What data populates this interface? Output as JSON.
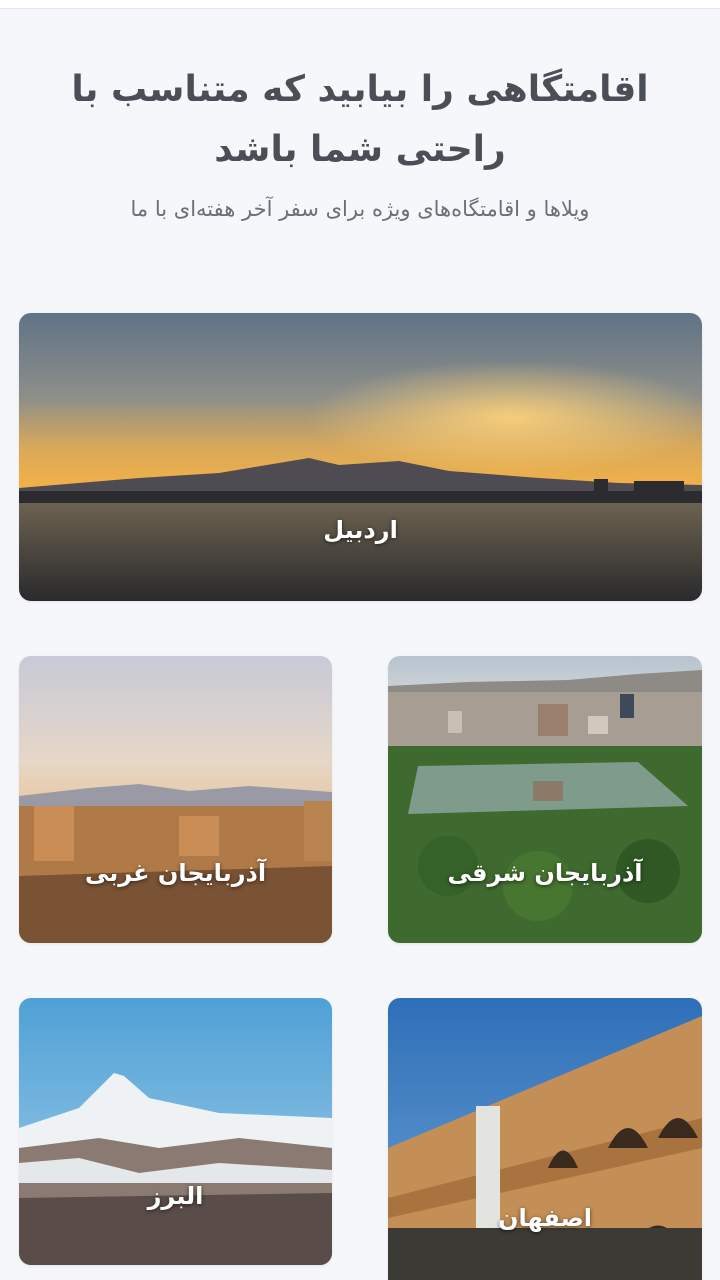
{
  "header": {
    "title": "اقامتگاهی را بیابید که متناسب با راحتی شما باشد",
    "subtitle": "ویلاها و اقامتگاه‌های ویژه برای سفر آخر هفته‌ای با ما"
  },
  "destinations": [
    {
      "label": "اردبیل",
      "scene": "lake-sunset"
    },
    {
      "label": "آذربایجان شرقی",
      "scene": "city-park-aerial"
    },
    {
      "label": "آذربایجان غربی",
      "scene": "ancient-ruins"
    },
    {
      "label": "اصفهان",
      "scene": "arched-bridge"
    },
    {
      "label": "البرز",
      "scene": "snowy-mountain"
    }
  ],
  "colors": {
    "background": "#f5f7fa",
    "title": "#4a4f57",
    "subtitle": "#6b7078",
    "card_label": "#ffffff"
  }
}
